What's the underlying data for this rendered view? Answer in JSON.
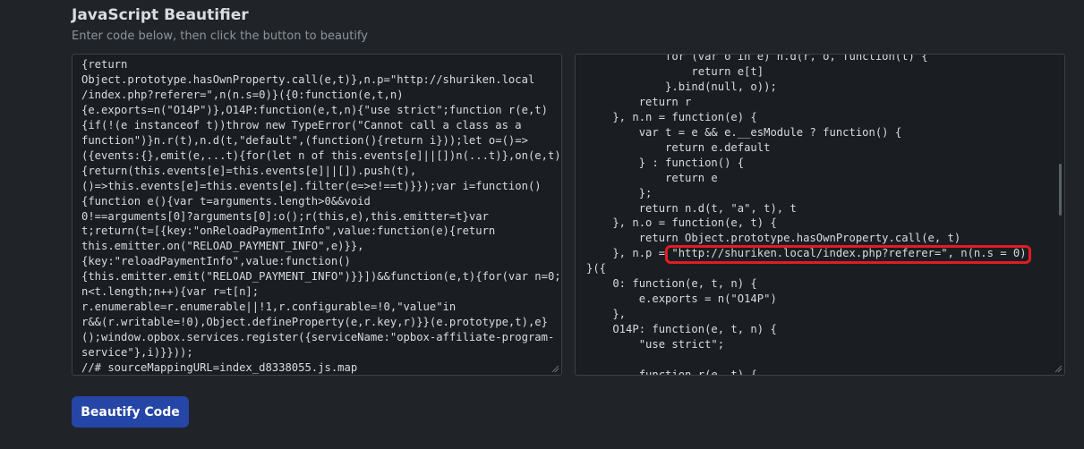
{
  "header": {
    "title": "JavaScript Beautifier",
    "subtitle": "Enter code below, then click the button to beautify"
  },
  "input": {
    "code": "{return\nObject.prototype.hasOwnProperty.call(e,t)},n.p=\"http://shuriken.local\n/index.php?referer=\",n(n.s=0)}({0:function(e,t,n)\n{e.exports=n(\"O14P\")},O14P:function(e,t,n){\"use strict\";function r(e,t)\n{if(!(e instanceof t))throw new TypeError(\"Cannot call a class as a\nfunction\")}n.r(t),n.d(t,\"default\",(function(){return i}));let o=()=>\n({events:{},emit(e,...t){for(let n of this.events[e]||[])n(...t)},on(e,t)\n{return(this.events[e]=this.events[e]||[]).push(t),\n()=>this.events[e]=this.events[e].filter(e=>e!==t)}});var i=function()\n{function e(){var t=arguments.length>0&&void\n0!==arguments[0]?arguments[0]:o();r(this,e),this.emitter=t}var\nt;return(t=[{key:\"onReloadPaymentInfo\",value:function(e){return\nthis.emitter.on(\"RELOAD_PAYMENT_INFO\",e)}},\n{key:\"reloadPaymentInfo\",value:function()\n{this.emitter.emit(\"RELOAD_PAYMENT_INFO\")}}])&&function(e,t){for(var n=0;\nn<t.length;n++){var r=t[n];\nr.enumerable=r.enumerable||!1,r.configurable=!0,\"value\"in\nr&&(r.writable=!0),Object.defineProperty(e,r.key,r)}}(e.prototype,t),e}\n();window.opbox.services.register({serviceName:\"opbox-affiliate-program-\nservice\"},i)}}));\n//# sourceMappingURL=index_d8338055.js.map"
  },
  "output": {
    "code": "            for (var o in e) n.d(r, o, function(t) {\n                return e[t]\n            }.bind(null, o));\n        return r\n    }, n.n = function(e) {\n        var t = e && e.__esModule ? function() {\n            return e.default\n        } : function() {\n            return e\n        };\n        return n.d(t, \"a\", t), t\n    }, n.o = function(e, t) {\n        return Object.prototype.hasOwnProperty.call(e, t)\n    }, n.p = \"http://shuriken.local/index.php?referer=\", n(n.s = 0)\n}({\n    0: function(e, t, n) {\n        e.exports = n(\"O14P\")\n    },\n    O14P: function(e, t, n) {\n        \"use strict\";\n\n        function r(e, t) {"
  },
  "button": {
    "label": "Beautify Code"
  },
  "colors": {
    "background": "#202327",
    "editor_bg": "#1a1d21",
    "accent": "#2546a6",
    "highlight": "#e21b23"
  }
}
